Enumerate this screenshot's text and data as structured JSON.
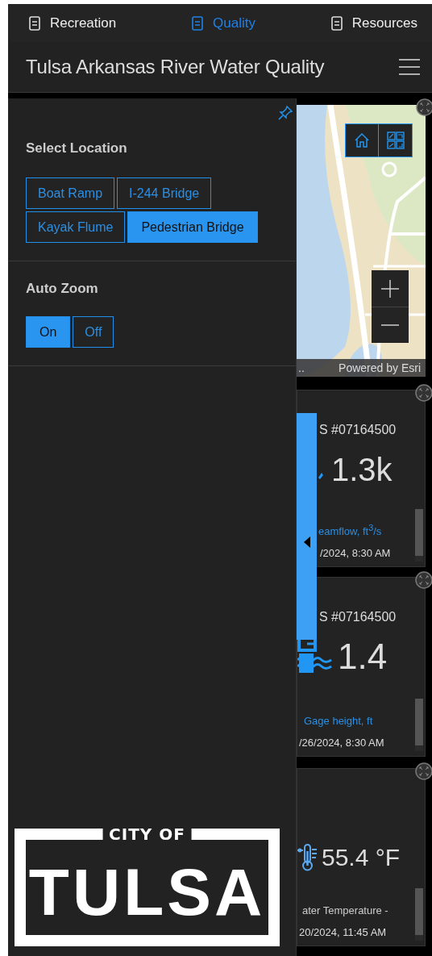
{
  "tabs": [
    {
      "label": "Recreation",
      "selected": false
    },
    {
      "label": "Quality",
      "selected": true
    },
    {
      "label": "Resources",
      "selected": false
    }
  ],
  "header": {
    "title": "Tulsa Arkansas River Water Quality"
  },
  "panel": {
    "sections": [
      {
        "title": "Select Location",
        "options": [
          {
            "label": "Boat Ramp",
            "selected": false
          },
          {
            "label": "I-244 Bridge",
            "selected": false
          },
          {
            "label": "Kayak Flume",
            "selected": false
          },
          {
            "label": "Pedestrian Bridge",
            "selected": true
          }
        ]
      },
      {
        "title": "Auto Zoom",
        "options": [
          {
            "label": "On",
            "selected": true
          },
          {
            "label": "Off",
            "selected": false
          }
        ]
      }
    ],
    "logo": {
      "line_1": "CITY OF",
      "line_2": "TULSA"
    }
  },
  "map": {
    "kind": "picture",
    "attribution": "..",
    "credit": "Powered by Esri"
  },
  "cards": [
    {
      "kind": "streamflow",
      "title": "S #07164500",
      "value": "1.3k",
      "label": "eamflow, ft$^{3}$/s",
      "date": "/2024, 8:30 AM"
    },
    {
      "kind": "gage",
      "title": "S #07164500",
      "value": "1.4",
      "label": "Gage height, ft",
      "date": "/26/2024, 8:30 AM"
    },
    {
      "kind": "temperature",
      "value": "55.4 °F",
      "label": "ater Temperature -",
      "date": "20/2024, 11:45 AM"
    }
  ]
}
